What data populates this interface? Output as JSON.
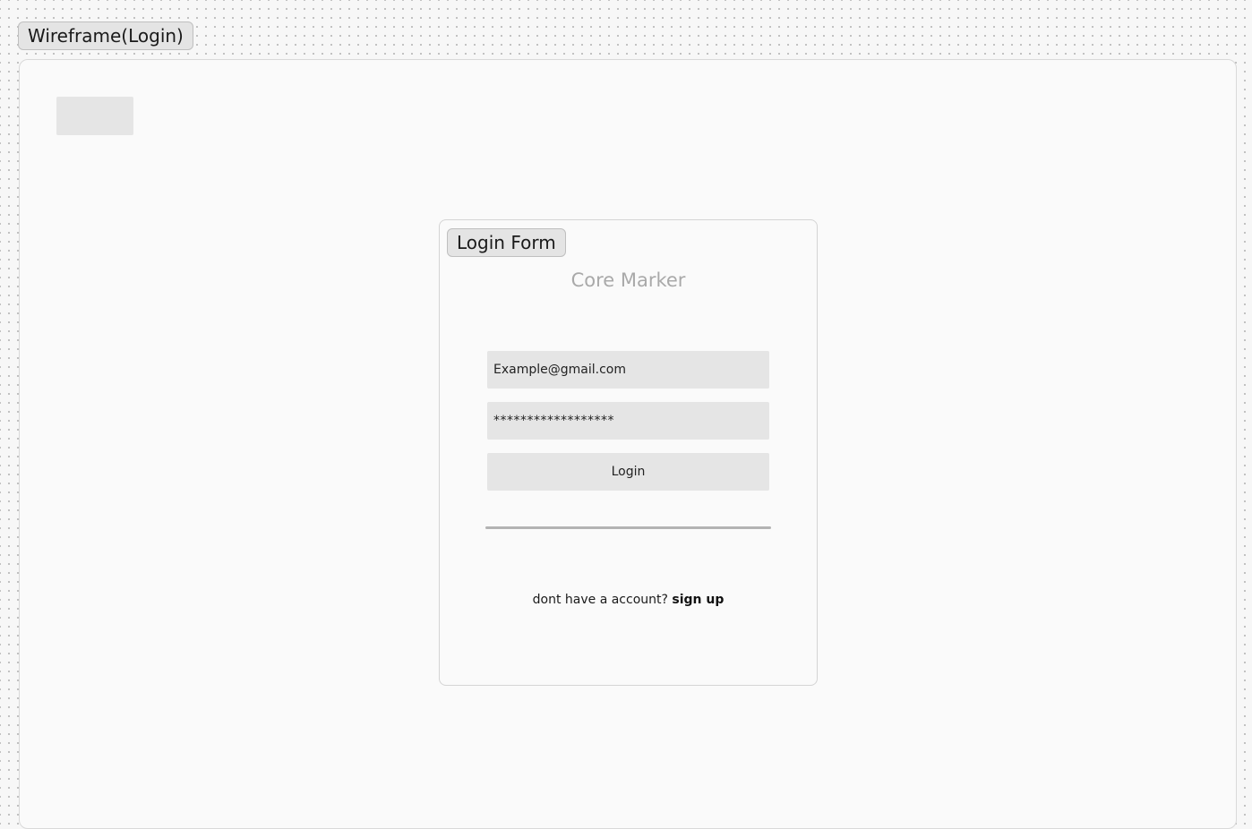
{
  "canvas": {
    "frame_label": "Wireframe(Login)"
  },
  "login_form": {
    "label": "Login Form",
    "brand_title": "Core Marker",
    "email_value": "Example@gmail.com",
    "password_value": "******************",
    "login_button_label": "Login",
    "signup_prompt": "dont have a account?",
    "signup_link_label": "sign up"
  },
  "colors": {
    "placeholder_fill": "#e5e5e5",
    "brand_title": "#a9a9a9",
    "divider": "#b3b3b3"
  }
}
